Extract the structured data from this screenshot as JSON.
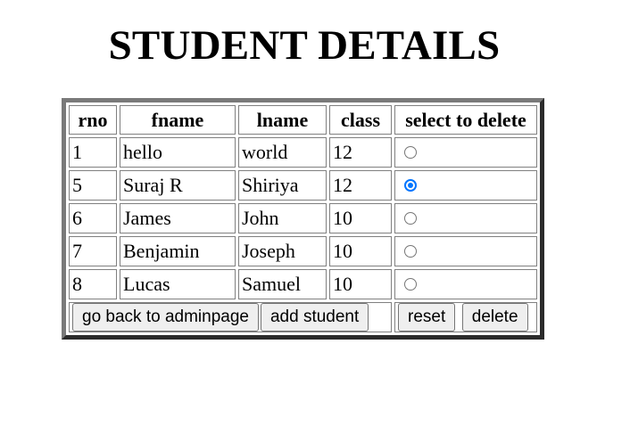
{
  "page": {
    "title": "STUDENT DETAILS"
  },
  "table": {
    "headers": [
      "rno",
      "fname",
      "lname",
      "class",
      "select to delete"
    ],
    "rows": [
      {
        "rno": "1",
        "fname": "hello",
        "lname": "world",
        "class": "12",
        "selected": false
      },
      {
        "rno": "5",
        "fname": "Suraj R",
        "lname": "Shiriya",
        "class": "12",
        "selected": true
      },
      {
        "rno": "6",
        "fname": "James",
        "lname": "John",
        "class": "10",
        "selected": false
      },
      {
        "rno": "7",
        "fname": "Benjamin",
        "lname": "Joseph",
        "class": "10",
        "selected": false
      },
      {
        "rno": "8",
        "fname": "Lucas",
        "lname": "Samuel",
        "class": "10",
        "selected": false
      }
    ]
  },
  "buttons": {
    "back_label": "go back to adminpage",
    "add_label": "add student",
    "reset_label": "reset",
    "delete_label": "delete"
  },
  "colors": {
    "radio_accent": "#0075ff",
    "button_bg": "#efefef"
  }
}
